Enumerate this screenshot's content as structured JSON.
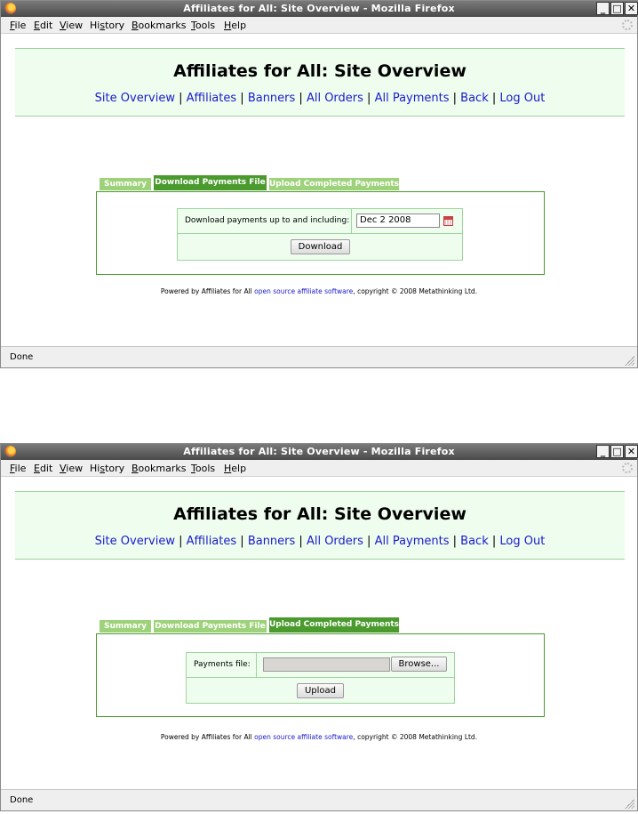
{
  "window_title": "Affiliates for All: Site Overview - Mozilla Firefox",
  "menu": {
    "file": "ile",
    "file_mn": "F",
    "edit": "dit",
    "edit_mn": "E",
    "view": "iew",
    "view_mn": "V",
    "history_pre": "Hi",
    "history_mn": "s",
    "history_post": "tory",
    "bookmarks": "ookmarks",
    "bookmarks_mn": "B",
    "tools": "ools",
    "tools_mn": "T",
    "help": "elp",
    "help_mn": "H"
  },
  "page": {
    "heading": "Affiliates for All: Site Overview",
    "nav": [
      "Site Overview",
      "Affiliates",
      "Banners",
      "All Orders",
      "All Payments",
      "Back",
      "Log Out"
    ],
    "nav_sep": " | "
  },
  "tabs": [
    "Summary",
    "Download Payments File",
    "Upload Completed Payments"
  ],
  "download_form": {
    "label": "Download payments up to and including:",
    "date_value": "Dec 2 2008",
    "button": "Download"
  },
  "upload_form": {
    "label": "Payments file:",
    "browse_button": "Browse...",
    "upload_button": "Upload"
  },
  "footer": {
    "prefix": "Powered by Affiliates for All ",
    "link": "open source affiliate software",
    "suffix": ", copyright © 2008 Metathinking Ltd."
  },
  "status": "Done",
  "window_buttons": {
    "minimize": "_",
    "maximize": "□",
    "close": "✕"
  }
}
